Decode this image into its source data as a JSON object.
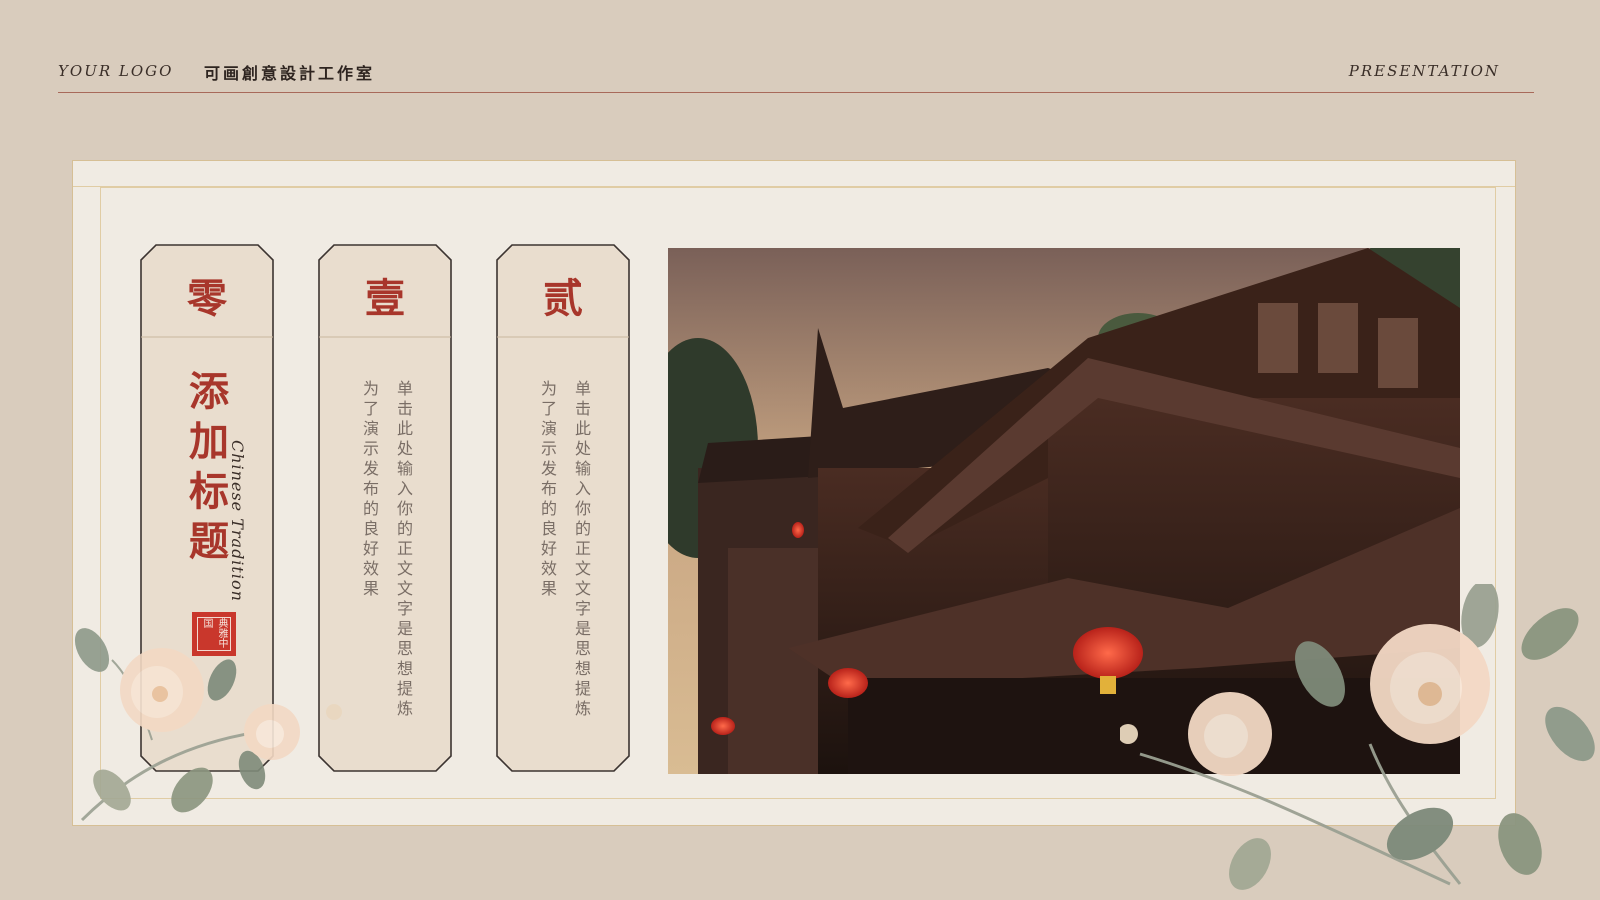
{
  "header": {
    "logo": "YOUR LOGO",
    "studio": "可画創意設計工作室",
    "right": "PRESENTATION"
  },
  "cards": [
    {
      "numeral": "零",
      "title": "添加标题",
      "subtitle": "Chinese Tradition",
      "seal": "典雅中国"
    },
    {
      "numeral": "壹",
      "body": "单击此处输入你的正文文字是思想提炼为了演示发布的良好效果"
    },
    {
      "numeral": "贰",
      "body": "单击此处输入你的正文文字是思想提炼为了演示发布的良好效果"
    }
  ],
  "colors": {
    "background": "#d9ccbd",
    "panel": "#f0ebe3",
    "card": "#e9ddce",
    "accent_red": "#a8362b",
    "seal_red": "#c9372c",
    "gold_line": "#d6bf95"
  },
  "icons": {
    "seal": "seal-stamp-icon",
    "floral": "peony-floral-decoration",
    "photo": "ancient-chinese-building-photo"
  }
}
